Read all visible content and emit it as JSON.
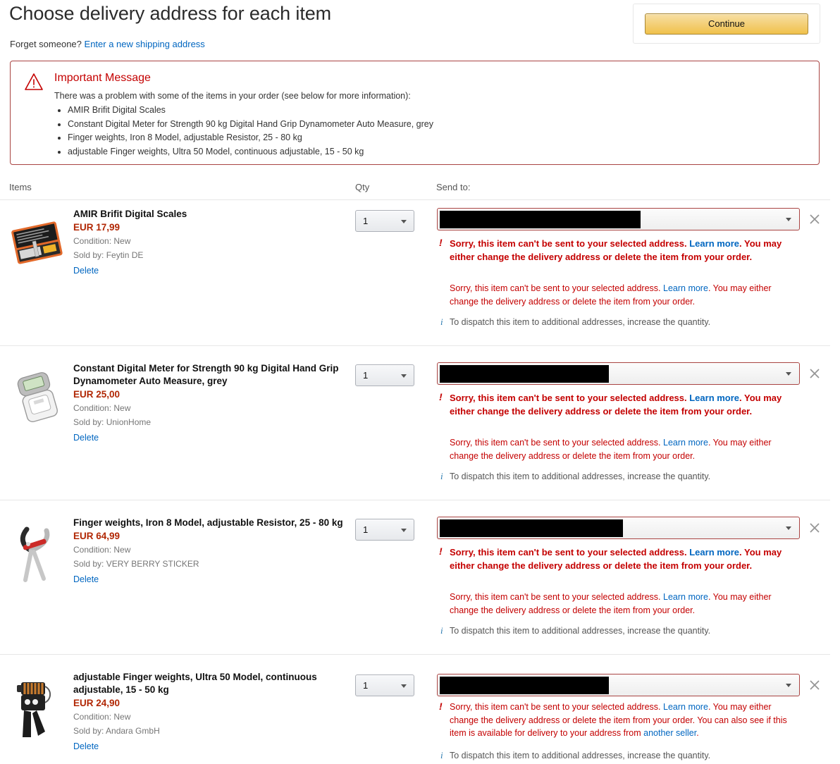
{
  "header": {
    "title": "Choose delivery address for each item",
    "forget_label": "Forget someone?",
    "new_address_link": "Enter a new shipping address",
    "continue_label": "Continue"
  },
  "important_message": {
    "title": "Important Message",
    "subtitle": "There was a problem with some of the items in your order (see below for more information):",
    "items": [
      "AMIR Brifit Digital Scales",
      "Constant Digital Meter for Strength 90 kg Digital Hand Grip Dynamometer Auto Measure, grey",
      "Finger weights, Iron 8 Model, adjustable Resistor, 25 - 80 kg",
      "adjustable Finger weights, Ultra 50 Model, continuous adjustable, 15 - 50 kg"
    ]
  },
  "columns": {
    "items": "Items",
    "qty": "Qty",
    "send_to": "Send to:"
  },
  "common": {
    "condition_label": "Condition: New",
    "delete_label": "Delete",
    "qty_value": "1",
    "info_message": "To dispatch this item to additional addresses, increase the quantity.",
    "error_part1": "Sorry, this item can't be sent to your selected address. ",
    "error_learn_more": "Learn more",
    "error_part2": ". You may either change the delivery address or delete the item from your order.",
    "error_extra": " You can also see if this item is available for delivery to your address from ",
    "error_another_seller": "another seller",
    "error_period": "."
  },
  "items": [
    {
      "title": "AMIR Brifit Digital Scales",
      "price": "EUR 17,99",
      "condition": "Condition: New",
      "sold_by": "Sold by: Feytin DE",
      "delete": "Delete",
      "qty": "1",
      "redaction_width": 285
    },
    {
      "title": "Constant Digital Meter for Strength 90 kg Digital Hand Grip Dynamometer Auto Measure, grey",
      "price": "EUR 25,00",
      "condition": "Condition: New",
      "sold_by": "Sold by: UnionHome",
      "delete": "Delete",
      "qty": "1",
      "redaction_width": 240
    },
    {
      "title": "Finger weights, Iron 8 Model, adjustable Resistor, 25 - 80 kg",
      "price": "EUR 64,99",
      "condition": "Condition: New",
      "sold_by": "Sold by: VERY BERRY STICKER",
      "delete": "Delete",
      "qty": "1",
      "redaction_width": 260
    },
    {
      "title": "adjustable Finger weights, Ultra 50 Model, continuous adjustable, 15 - 50 kg",
      "price": "EUR 24,90",
      "condition": "Condition: New",
      "sold_by": "Sold by: Andara GmbH",
      "delete": "Delete",
      "qty": "1",
      "redaction_width": 240
    }
  ],
  "colors": {
    "error_red": "#c40000",
    "border_red": "#a94442",
    "link_blue": "#0066c0",
    "price_red": "#b12704",
    "button_yellow": "#f0c14b"
  }
}
